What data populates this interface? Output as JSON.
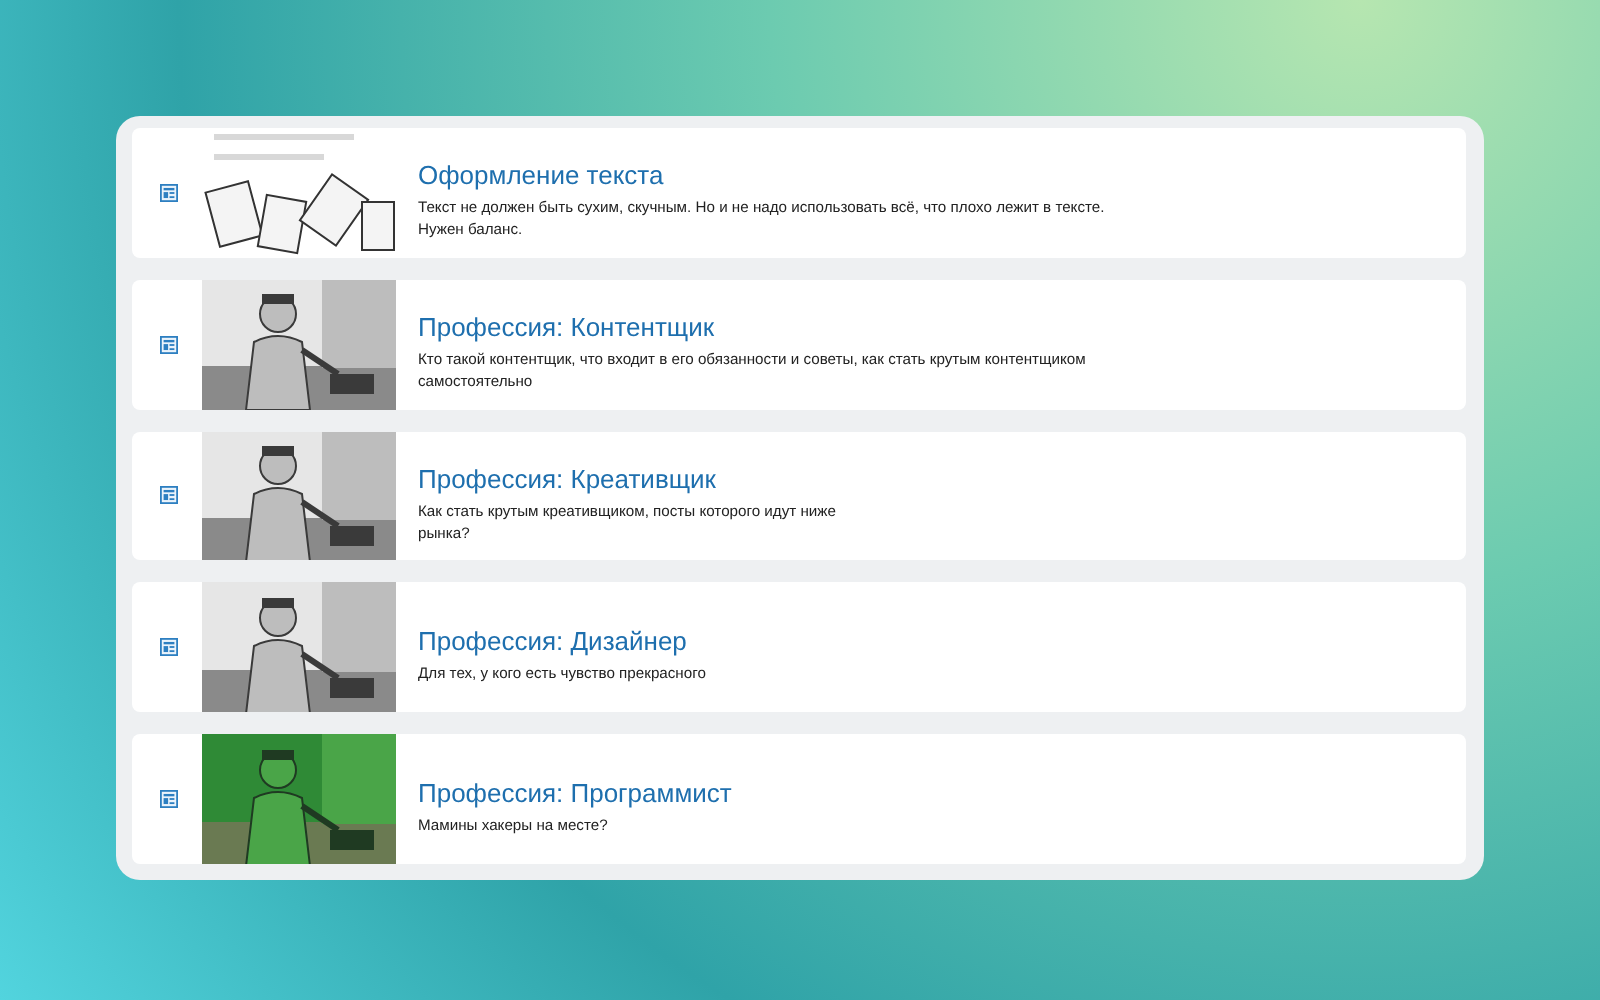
{
  "articles": [
    {
      "title": "Оформление текста",
      "description": "Текст не должен быть сухим, скучным. Но и не надо использовать всё, что плохо лежит в тексте. Нужен баланс."
    },
    {
      "title": "Профессия: Контентщик",
      "description": "Кто такой контентщик, что входит в его обязанности и советы, как стать крутым контентщиком самостоятельно"
    },
    {
      "title": "Профессия: Креативщик",
      "description": "Как стать крутым креативщиком, посты которого идут ниже рынка?"
    },
    {
      "title": "Профессия: Дизайнер",
      "description": "Для тех, у кого есть чувство прекрасного"
    },
    {
      "title": "Профессия: Программист",
      "description": "Мамины хакеры на месте?"
    }
  ]
}
